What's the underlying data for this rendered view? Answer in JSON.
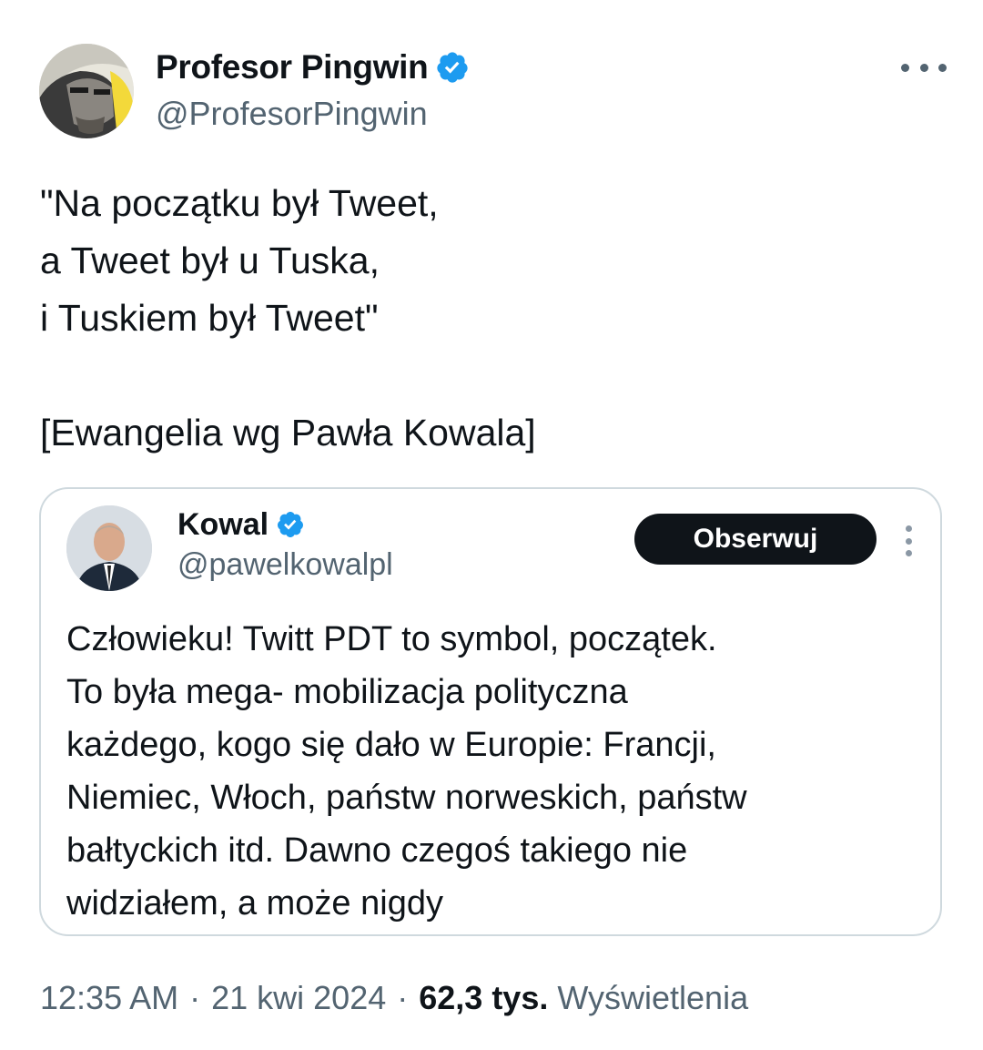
{
  "author": {
    "display_name": "Profesor Pingwin",
    "handle": "@ProfesorPingwin",
    "verified": true,
    "avatar_icon": "avatar-illustration-icon"
  },
  "more_icon": "more-horizontal-icon",
  "body": {
    "lines": [
      "\"Na początku był Tweet,",
      "a Tweet był u Tuska,",
      "i Tuskiem był Tweet\""
    ],
    "signature": "[Ewangelia wg Pawła Kowala]"
  },
  "quoted": {
    "display_name": "Kowal",
    "handle": "@pawelkowalpl",
    "verified": true,
    "follow_label": "Obserwuj",
    "more_icon": "more-vertical-icon",
    "lines": [
      "Człowieku! Twitt PDT to symbol, początek.",
      "To była mega- mobilizacja polityczna",
      "każdego, kogo się dało w Europie: Francji,",
      "Niemiec, Włoch, państw norweskich, państw",
      "bałtyckich itd. Dawno czegoś takiego nie",
      "widziałem, a może nigdy"
    ]
  },
  "meta": {
    "time": "12:35 AM",
    "separator": "·",
    "date": "21 kwi 2024",
    "views_count": "62,3 tys.",
    "views_label": "Wyświetlenia"
  },
  "colors": {
    "verified_blue": "#1d9bf0",
    "text_primary": "#0f1419",
    "text_secondary": "#536471",
    "border": "#cfd9de"
  }
}
